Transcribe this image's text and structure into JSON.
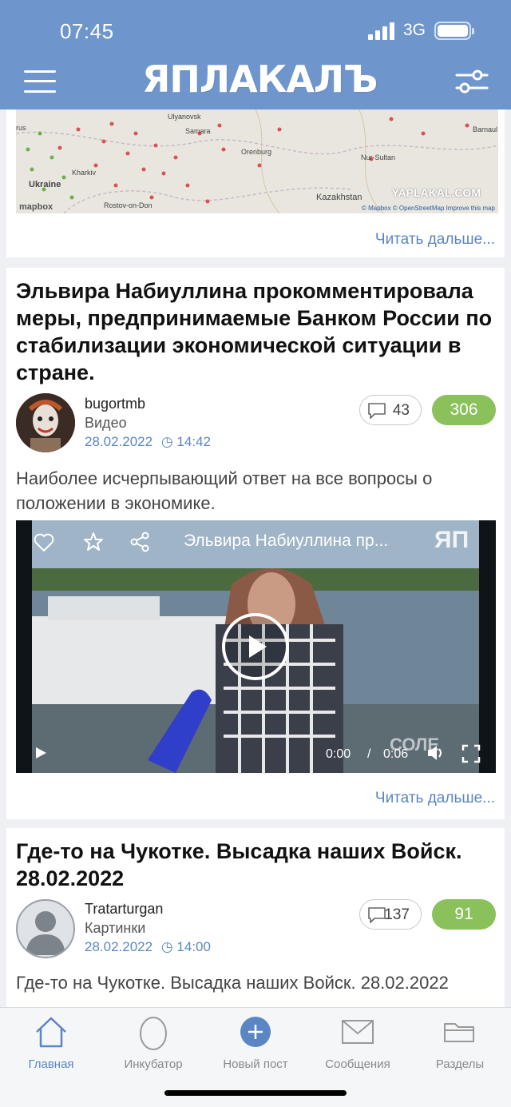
{
  "status": {
    "time": "07:45",
    "network": "3G"
  },
  "header": {
    "logo": "ЯПЛАКАЛЪ"
  },
  "map": {
    "labels": [
      "Ulyanovsk",
      "Samara",
      "Orenburg",
      "Nur-Sultan",
      "Barnaul",
      "Kharkiv",
      "Ukraine",
      "Rostov-on-Don",
      "Kazakhstan",
      "rus"
    ],
    "watermark": "YAPLAKAL.COM",
    "mapbox": "mapbox",
    "credit": "© Mapbox © OpenStreetMap Improve this map"
  },
  "read_more": "Читать дальше...",
  "posts": [
    {
      "title": "Эльвира Набиуллина прокомментировала меры, предпринимаемые Банком России по стабилизации экономической ситуации в стране.",
      "author": "bugortmb",
      "category": "Видео",
      "date": "28.02.2022",
      "time": "14:42",
      "comments": "43",
      "rating": "306",
      "text": "Наиболее исчерпывающий ответ на все вопросы о положении в экономике.",
      "video": {
        "title": "Эльвира Набиуллина пр...",
        "current": "0:00",
        "separator": "/",
        "duration": "0:06",
        "watermark": "ЯП",
        "channel": "СОЛЕ"
      }
    },
    {
      "title": "Где-то на Чукотке. Высадка наших Войск. 28.02.2022",
      "author": "Tratarturgan",
      "category": "Картинки",
      "date": "28.02.2022",
      "time": "14:00",
      "comments": "137",
      "rating": "91",
      "text": "Где-то на Чукотке. Высадка наших Войск. 28.02.2022"
    }
  ],
  "tabs": [
    {
      "label": "Главная",
      "icon": "home-icon",
      "active": true
    },
    {
      "label": "Инкубатор",
      "icon": "egg-icon"
    },
    {
      "label": "Новый пост",
      "icon": "plus-icon"
    },
    {
      "label": "Сообщения",
      "icon": "envelope-icon"
    },
    {
      "label": "Разделы",
      "icon": "folder-icon"
    }
  ],
  "colors": {
    "header": "#6f96cc",
    "accent": "#5a86c4",
    "rating": "#8bc15b"
  }
}
